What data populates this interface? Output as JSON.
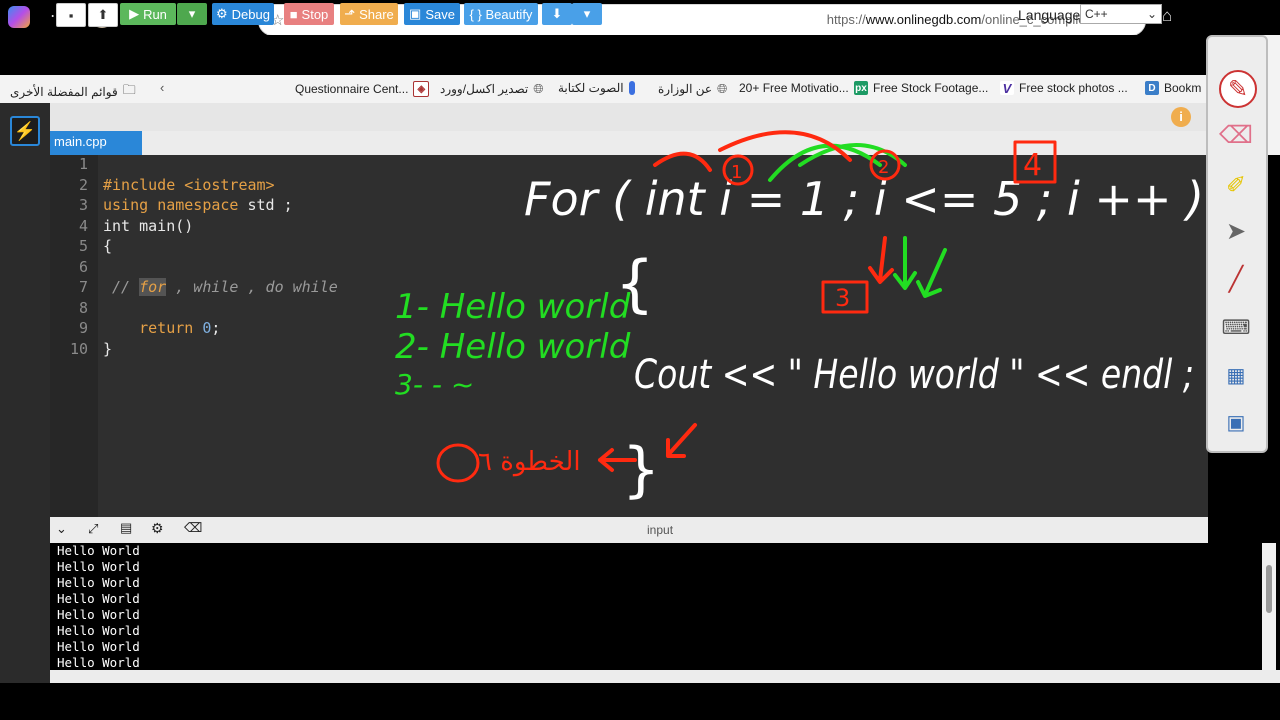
{
  "browser": {
    "url_prefix": "https://",
    "url_domain": "www.onlinegdb.com",
    "url_path": "/online_c_compiler#",
    "read_aloud": "A⁾",
    "bookmarks": [
      {
        "label": "قوائم المفضلة الأخرى"
      },
      {
        "label": "Questionnaire Cent..."
      },
      {
        "label": "تصدير اكسل/وورد"
      },
      {
        "label": "الصوت لكتابة"
      },
      {
        "label": "عن الوزارة"
      },
      {
        "label": "20+ Free Motivatio..."
      },
      {
        "label": "Free Stock Footage..."
      },
      {
        "label": "Free stock photos ..."
      },
      {
        "label": "Bookm"
      }
    ]
  },
  "toolbar": {
    "run": "Run",
    "debug": "Debug",
    "stop": "Stop",
    "share": "Share",
    "save": "Save",
    "beautify": "{ } Beautify",
    "language_label": "Language",
    "language_value": "C++"
  },
  "editor": {
    "file_tab": "main.cpp",
    "line_numbers": [
      "1",
      "2",
      "3",
      "4",
      "5",
      "6",
      "7",
      "8",
      "9",
      "10"
    ],
    "lines": {
      "l2a": "#include ",
      "l2b": "<iostream>",
      "l3a": "using",
      "l3b": " ",
      "l3c": "namespace",
      "l3d": " std ;",
      "l4": "int main()",
      "l5": "{",
      "l7a": " // ",
      "l7b": "for",
      "l7c": " , while , do while",
      "l9a": "    ",
      "l9b": "return",
      "l9c": " ",
      "l9d": "0",
      "l9e": ";",
      "l10": "}"
    }
  },
  "console": {
    "title": "input",
    "lines": [
      "Hello World",
      "Hello World",
      "Hello World",
      "Hello World",
      "Hello World",
      "Hello World",
      "Hello World",
      "Hello World"
    ]
  },
  "annotations": {
    "for_stmt": "For ( int i = 1 ; i <= 5 ; i ++ )",
    "cout_stmt": "Cout << \" Hello world \" << endl ;",
    "open_brace": "{",
    "close_brace": "}",
    "list_1": "1- Hello world",
    "list_2": "2- Hello world",
    "list_3": "3-  -    ~",
    "marker_1": "1",
    "marker_2": "2",
    "marker_3": "3",
    "marker_4": "4",
    "arabic_note": "الخطوة ٦"
  },
  "colors": {
    "run_green": "#5cb85c",
    "debug_blue": "#2a87d8",
    "stop_red": "#e85a5a",
    "share_orange": "#f0ad4e",
    "ink_white": "#ffffff",
    "ink_green": "#22dd22",
    "ink_red": "#ff2a10"
  }
}
